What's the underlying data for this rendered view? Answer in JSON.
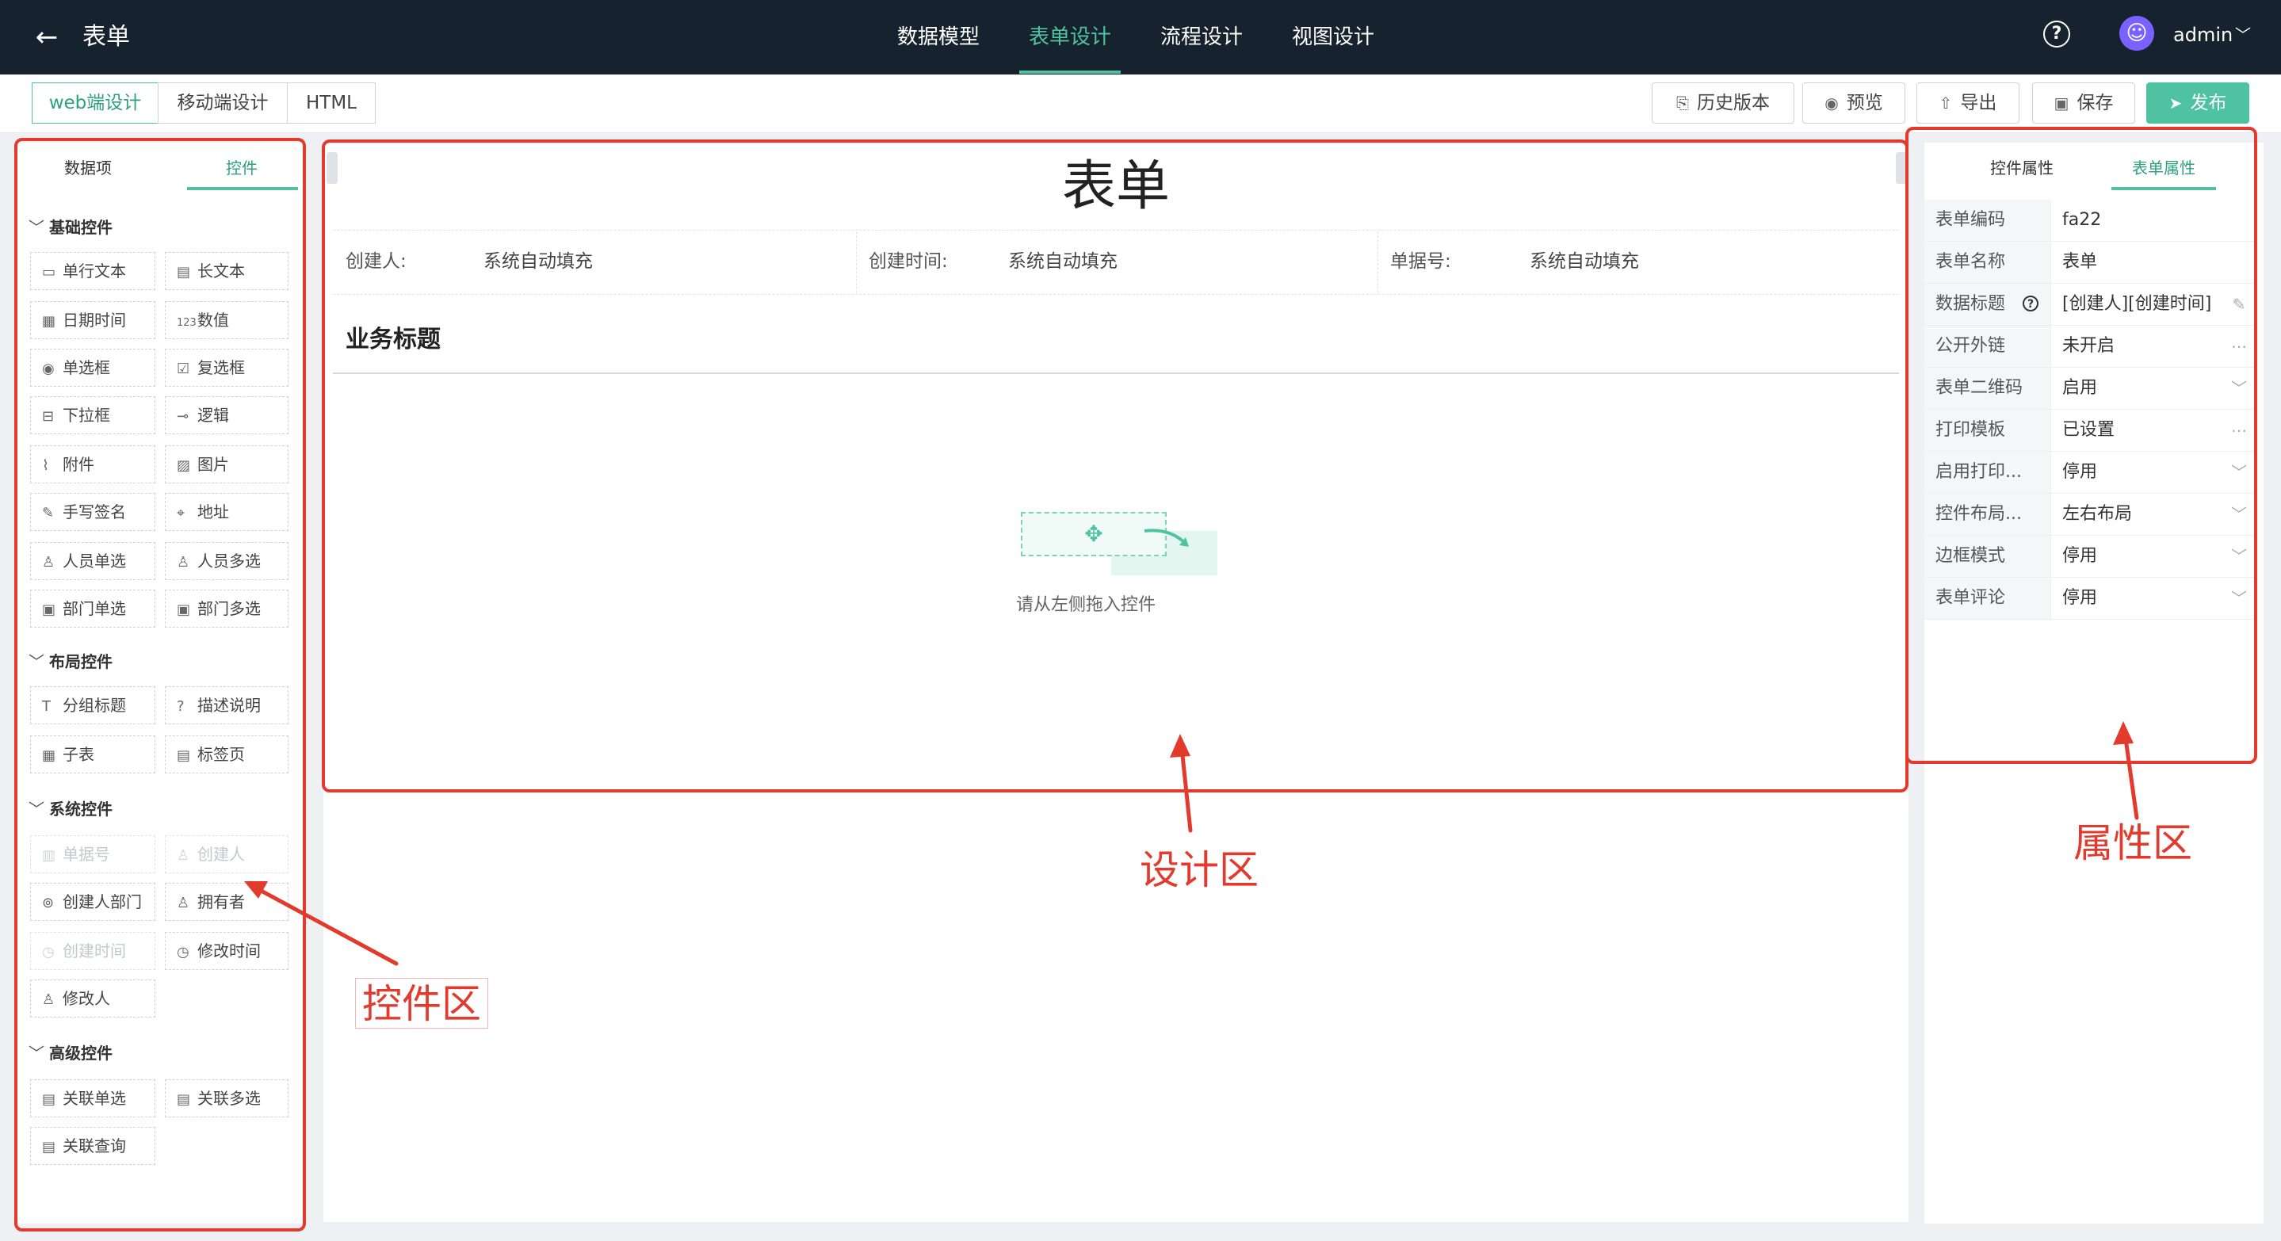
{
  "header": {
    "title": "表单",
    "tabs": [
      {
        "label": "数据模型"
      },
      {
        "label": "表单设计"
      },
      {
        "label": "流程设计"
      },
      {
        "label": "视图设计"
      }
    ],
    "active_tab": "表单设计",
    "user": "admin",
    "help_glyph": "?"
  },
  "toolbar": {
    "modes": [
      "web端设计",
      "移动端设计",
      "HTML"
    ],
    "active_mode": "web端设计",
    "history": "历史版本",
    "preview": "预览",
    "export": "导出",
    "save": "保存",
    "publish": "发布"
  },
  "left_panel": {
    "tabs": [
      "数据项",
      "控件"
    ],
    "active_tab": "控件",
    "groups": [
      {
        "title": "基础控件",
        "items": [
          "单行文本",
          "长文本",
          "日期时间",
          "数值",
          "单选框",
          "复选框",
          "下拉框",
          "逻辑",
          "附件",
          "图片",
          "手写签名",
          "地址",
          "人员单选",
          "人员多选",
          "部门单选",
          "部门多选"
        ]
      },
      {
        "title": "布局控件",
        "items": [
          "分组标题",
          "描述说明",
          "子表",
          "标签页"
        ]
      },
      {
        "title": "系统控件",
        "items": [
          "单据号",
          "创建人",
          "创建人部门",
          "拥有者",
          "创建时间",
          "修改时间",
          "修改人"
        ],
        "disabled": [
          "单据号",
          "创建人",
          "创建时间"
        ]
      },
      {
        "title": "高级控件",
        "items": [
          "关联单选",
          "关联多选",
          "关联查询"
        ]
      }
    ]
  },
  "design": {
    "form_title": "表单",
    "meta": [
      {
        "label": "创建人:",
        "value": "系统自动填充"
      },
      {
        "label": "创建时间:",
        "value": "系统自动填充"
      },
      {
        "label": "单据号:",
        "value": "系统自动填充"
      }
    ],
    "biz_title": "业务标题",
    "drop_hint": "请从左侧拖入控件"
  },
  "right_panel": {
    "tabs": [
      "控件属性",
      "表单属性"
    ],
    "active_tab": "表单属性",
    "props": [
      {
        "label": "表单编码",
        "value": "fa22"
      },
      {
        "label": "表单名称",
        "value": "表单"
      },
      {
        "label": "数据标题",
        "value": "[创建人][创建时间]"
      },
      {
        "label": "公开外链",
        "value": "未开启"
      },
      {
        "label": "表单二维码",
        "value": "启用"
      },
      {
        "label": "打印模板",
        "value": "已设置"
      },
      {
        "label": "启用打印...",
        "value": "停用"
      },
      {
        "label": "控件布局...",
        "value": "左右布局"
      },
      {
        "label": "边框模式",
        "value": "停用"
      },
      {
        "label": "表单评论",
        "value": "停用"
      }
    ]
  },
  "annotations": {
    "controls_area": "控件区",
    "design_area": "设计区",
    "property_area": "属性区"
  },
  "colors": {
    "topbar": "#17222f",
    "accent": "#4fc3a1",
    "annotation_red": "#e23b2e",
    "avatar": "#7b61ff"
  }
}
